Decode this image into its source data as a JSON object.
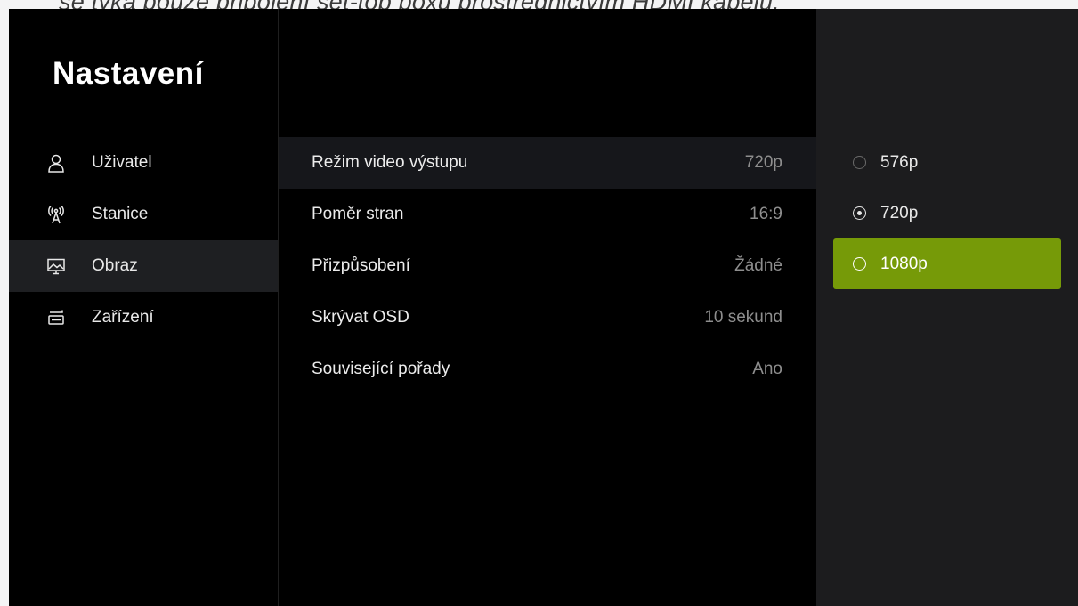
{
  "caption": "se týká pouze připojení set-top boxu prostřednictvím HDMI kabelu.",
  "sidebar": {
    "title": "Nastavení",
    "items": [
      {
        "label": "Uživatel",
        "icon": "user-icon",
        "active": false
      },
      {
        "label": "Stanice",
        "icon": "antenna-icon",
        "active": false
      },
      {
        "label": "Obraz",
        "icon": "display-icon",
        "active": true
      },
      {
        "label": "Zařízení",
        "icon": "device-icon",
        "active": false
      }
    ]
  },
  "settings": {
    "rows": [
      {
        "label": "Režim video výstupu",
        "value": "720p",
        "selected": true
      },
      {
        "label": "Poměr stran",
        "value": "16:9"
      },
      {
        "label": "Přizpůsobení",
        "value": "Žádné"
      },
      {
        "label": "Skrývat OSD",
        "value": "10 sekund"
      },
      {
        "label": "Související pořady",
        "value": "Ano"
      }
    ]
  },
  "options": {
    "items": [
      {
        "label": "576p",
        "checked": false
      },
      {
        "label": "720p",
        "checked": true
      },
      {
        "label": "1080p",
        "checked": false,
        "focused": true
      }
    ]
  },
  "colors": {
    "accent": "#769a08",
    "panel_bg": "#1c1c1e",
    "active_nav_bg": "#1e1f22"
  }
}
